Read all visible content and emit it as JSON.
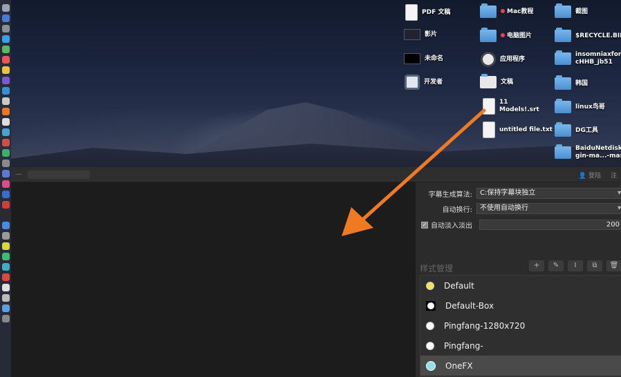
{
  "desktop": {
    "icons": [
      {
        "label": "PDF 文稿",
        "kind": "doc"
      },
      {
        "label": "影片",
        "kind": "thumb"
      },
      {
        "label": "未命名",
        "kind": "thumb"
      },
      {
        "label": "开发者",
        "kind": "app"
      },
      {
        "label": "Mac教程",
        "kind": "folder",
        "tag": true
      },
      {
        "label": "电脑图片",
        "kind": "folder",
        "tag": true
      },
      {
        "label": "应用程序",
        "kind": "app"
      },
      {
        "label": "文稿",
        "kind": "folder"
      },
      {
        "label": "11 Models!.srt",
        "kind": "doc"
      },
      {
        "label": "untitled file.txt",
        "kind": "doc"
      },
      {
        "label": "截图",
        "kind": "folder"
      },
      {
        "label": "$RECYCLE.BIN",
        "kind": "folder"
      },
      {
        "label": "insomniaxformac_cHHB_jb51",
        "kind": "folder"
      },
      {
        "label": "韩国",
        "kind": "folder"
      },
      {
        "label": "linux鸟哥",
        "kind": "folder"
      },
      {
        "label": "DG工具",
        "kind": "folder"
      },
      {
        "label": "BaiduNetdiskPlugin-ma...-master",
        "kind": "folder"
      }
    ],
    "icon_labels_display": {
      "insomnia": "insomniaxforma\ncHHB_jb51",
      "baidu": "BaiduNetdiskPl\ngin-ma...-maste"
    }
  },
  "titlebar": {
    "login": "登陆",
    "right_partial": "注"
  },
  "panel": {
    "subtitle_algo_label": "字幕生成算法:",
    "subtitle_algo_value": "C:保持字幕块独立",
    "auto_wrap_label": "自动换行:",
    "auto_wrap_value": "不使用自动换行",
    "fade_label": "自动淡入淡出",
    "fade_checked": true,
    "fade_value": "200",
    "style_manager_title": "样式管理",
    "tools": [
      "+",
      "✎",
      "I",
      "⧉",
      "🗑"
    ],
    "styles": [
      {
        "name": "Default",
        "color": "#f3e35a",
        "type": "circle"
      },
      {
        "name": "Default-Box",
        "color": "#ffffff",
        "type": "box"
      },
      {
        "name": "Pingfang-1280x720",
        "color": "#ffffff",
        "type": "circle"
      },
      {
        "name": "Pingfang-",
        "color": "#ffffff",
        "type": "circle"
      },
      {
        "name": "OneFX",
        "color": "#8fe0ee",
        "type": "circle",
        "selected": true
      }
    ]
  },
  "colors": {
    "arrow": "#f07a22",
    "panel_bg": "#2b2b2b"
  }
}
